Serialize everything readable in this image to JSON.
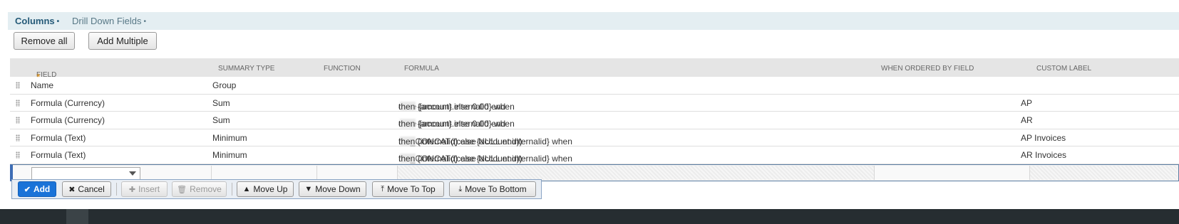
{
  "tabs": [
    {
      "label": "Columns",
      "active": true
    },
    {
      "label": "Drill Down Fields",
      "active": false
    }
  ],
  "toolbar": {
    "remove_all": "Remove all",
    "add_multiple": "Add Multiple"
  },
  "columns": {
    "field": "Field",
    "required_mark": "*",
    "summary_type": "Summary Type",
    "function": "Function",
    "formula": "Formula",
    "when_ordered": "When Ordered By Field",
    "custom_label": "Custom Label"
  },
  "rows": [
    {
      "field": "Name",
      "summary": "Group",
      "formula_a": "",
      "formula_b": "",
      "label": ""
    },
    {
      "field": "Formula (Currency)",
      "summary": "Sum",
      "formula_a": "case {account.internalid} when",
      "formula_b": "then {amount} else 0.00 end",
      "label": "AP"
    },
    {
      "field": "Formula (Currency)",
      "summary": "Sum",
      "formula_a": "case {account.internalid} when",
      "formula_b": "then {amount} else 0.00 end",
      "label": "AR"
    },
    {
      "field": "Formula (Text)",
      "summary": "Minimum",
      "formula_a": "NS_CONCAT((case {account.internalid} when",
      "formula_b": "then {internalid} else NULL end))",
      "label": "AP Invoices"
    },
    {
      "field": "Formula (Text)",
      "summary": "Minimum",
      "formula_a": "NS_CONCAT((case {account.internalid} when",
      "formula_b": "then {internalid} else NULL end))",
      "label": "AR Invoices"
    }
  ],
  "actions": {
    "add": "Add",
    "cancel": "Cancel",
    "insert": "Insert",
    "remove": "Remove",
    "move_up": "Move Up",
    "move_down": "Move Down",
    "move_to_top": "Move To Top",
    "move_to_bottom": "Move To Bottom"
  },
  "colors": {
    "primary": "#1a73d8",
    "tab_active": "#255a78",
    "required": "#e08d0b"
  }
}
